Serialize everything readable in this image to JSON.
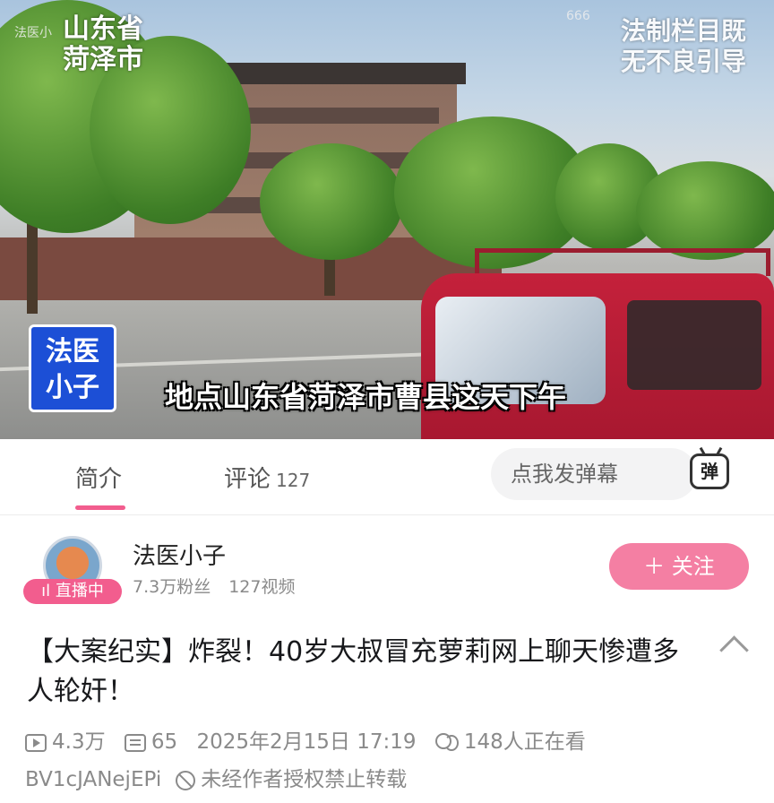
{
  "video": {
    "watermark_small": "法医小",
    "location_watermark": [
      "山东省",
      "菏泽市"
    ],
    "view_overlay": "666",
    "column_watermark": [
      "法制栏目既",
      "无不良引导"
    ],
    "channel_logo": [
      "法医",
      "小子"
    ],
    "subtitle": "地点山东省菏泽市曹县这天下午"
  },
  "tabs": {
    "intro": "简介",
    "comments": "评论",
    "comment_count": "127",
    "danmaku_placeholder": "点我发弹幕",
    "danmaku_icon_label": "弹"
  },
  "author": {
    "name": "法医小子",
    "fans": "7.3万粉丝",
    "videos": "127视频",
    "live_badge": "直播中",
    "follow_label": "＋ 关注"
  },
  "video_info": {
    "title": "【大案纪实】炸裂！40岁大叔冒充萝莉网上聊天惨遭多人轮奸！",
    "views": "4.3万",
    "danmaku_count": "65",
    "date": "2025年2月15日",
    "time": "17:19",
    "watching": "148人正在看",
    "bvid": "BV1cJANejEPi",
    "copyright_note": "未经作者授权禁止转载"
  },
  "colors": {
    "accent": "#f25d8e",
    "follow_bg": "#f47fa3",
    "logo_blue": "#1c4fd6"
  }
}
